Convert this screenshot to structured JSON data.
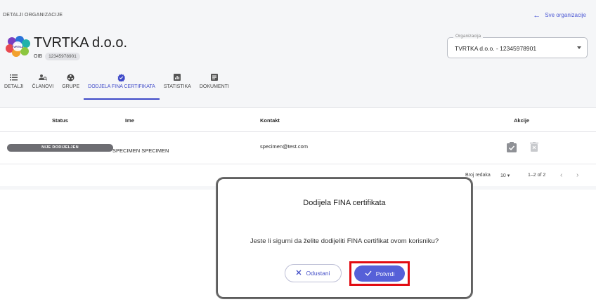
{
  "breadcrumb": "DETALJI ORGANIZACIJE",
  "back_link": "Sve organizacije",
  "org": {
    "name": "TVRTKA d.o.o.",
    "oib_label": "OIB",
    "oib": "12345978901",
    "logo_text": "TVRTKA"
  },
  "org_select": {
    "label": "Organizacija",
    "value": "TVRTKA d.o.o. - 12345978901"
  },
  "tabs": [
    {
      "label": "DETALJI",
      "icon": "list-icon"
    },
    {
      "label": "ČLANOVI",
      "icon": "people-icon"
    },
    {
      "label": "GRUPE",
      "icon": "group-icon"
    },
    {
      "label": "DODJELA FINA CERTIFIKATA",
      "icon": "verified-icon",
      "active": true
    },
    {
      "label": "STATISTIKA",
      "icon": "chart-icon"
    },
    {
      "label": "DOKUMENTI",
      "icon": "document-icon"
    }
  ],
  "table": {
    "headers": [
      "Status",
      "Ime",
      "Kontakt",
      "Akcije"
    ],
    "rows": [
      {
        "status": "NIJE DODIJELJEN",
        "name": "SPECIMEN SPECIMEN",
        "contact": "specimen@test.com"
      }
    ],
    "footer": {
      "rows_label": "Broj redaka",
      "rows_per_page": "10",
      "range": "1–2 of 2"
    }
  },
  "modal": {
    "title": "Dodijela FINA certifikata",
    "text": "Jeste li sigurni da želite dodijeliti FINA certifikat ovom korisniku?",
    "cancel": "Odustani",
    "confirm": "Potvrdi"
  },
  "colors": {
    "primary": "#5660d8",
    "tab_active": "#3e49c8",
    "highlight": "#e20b12",
    "status_pill": "#6d6d72"
  }
}
